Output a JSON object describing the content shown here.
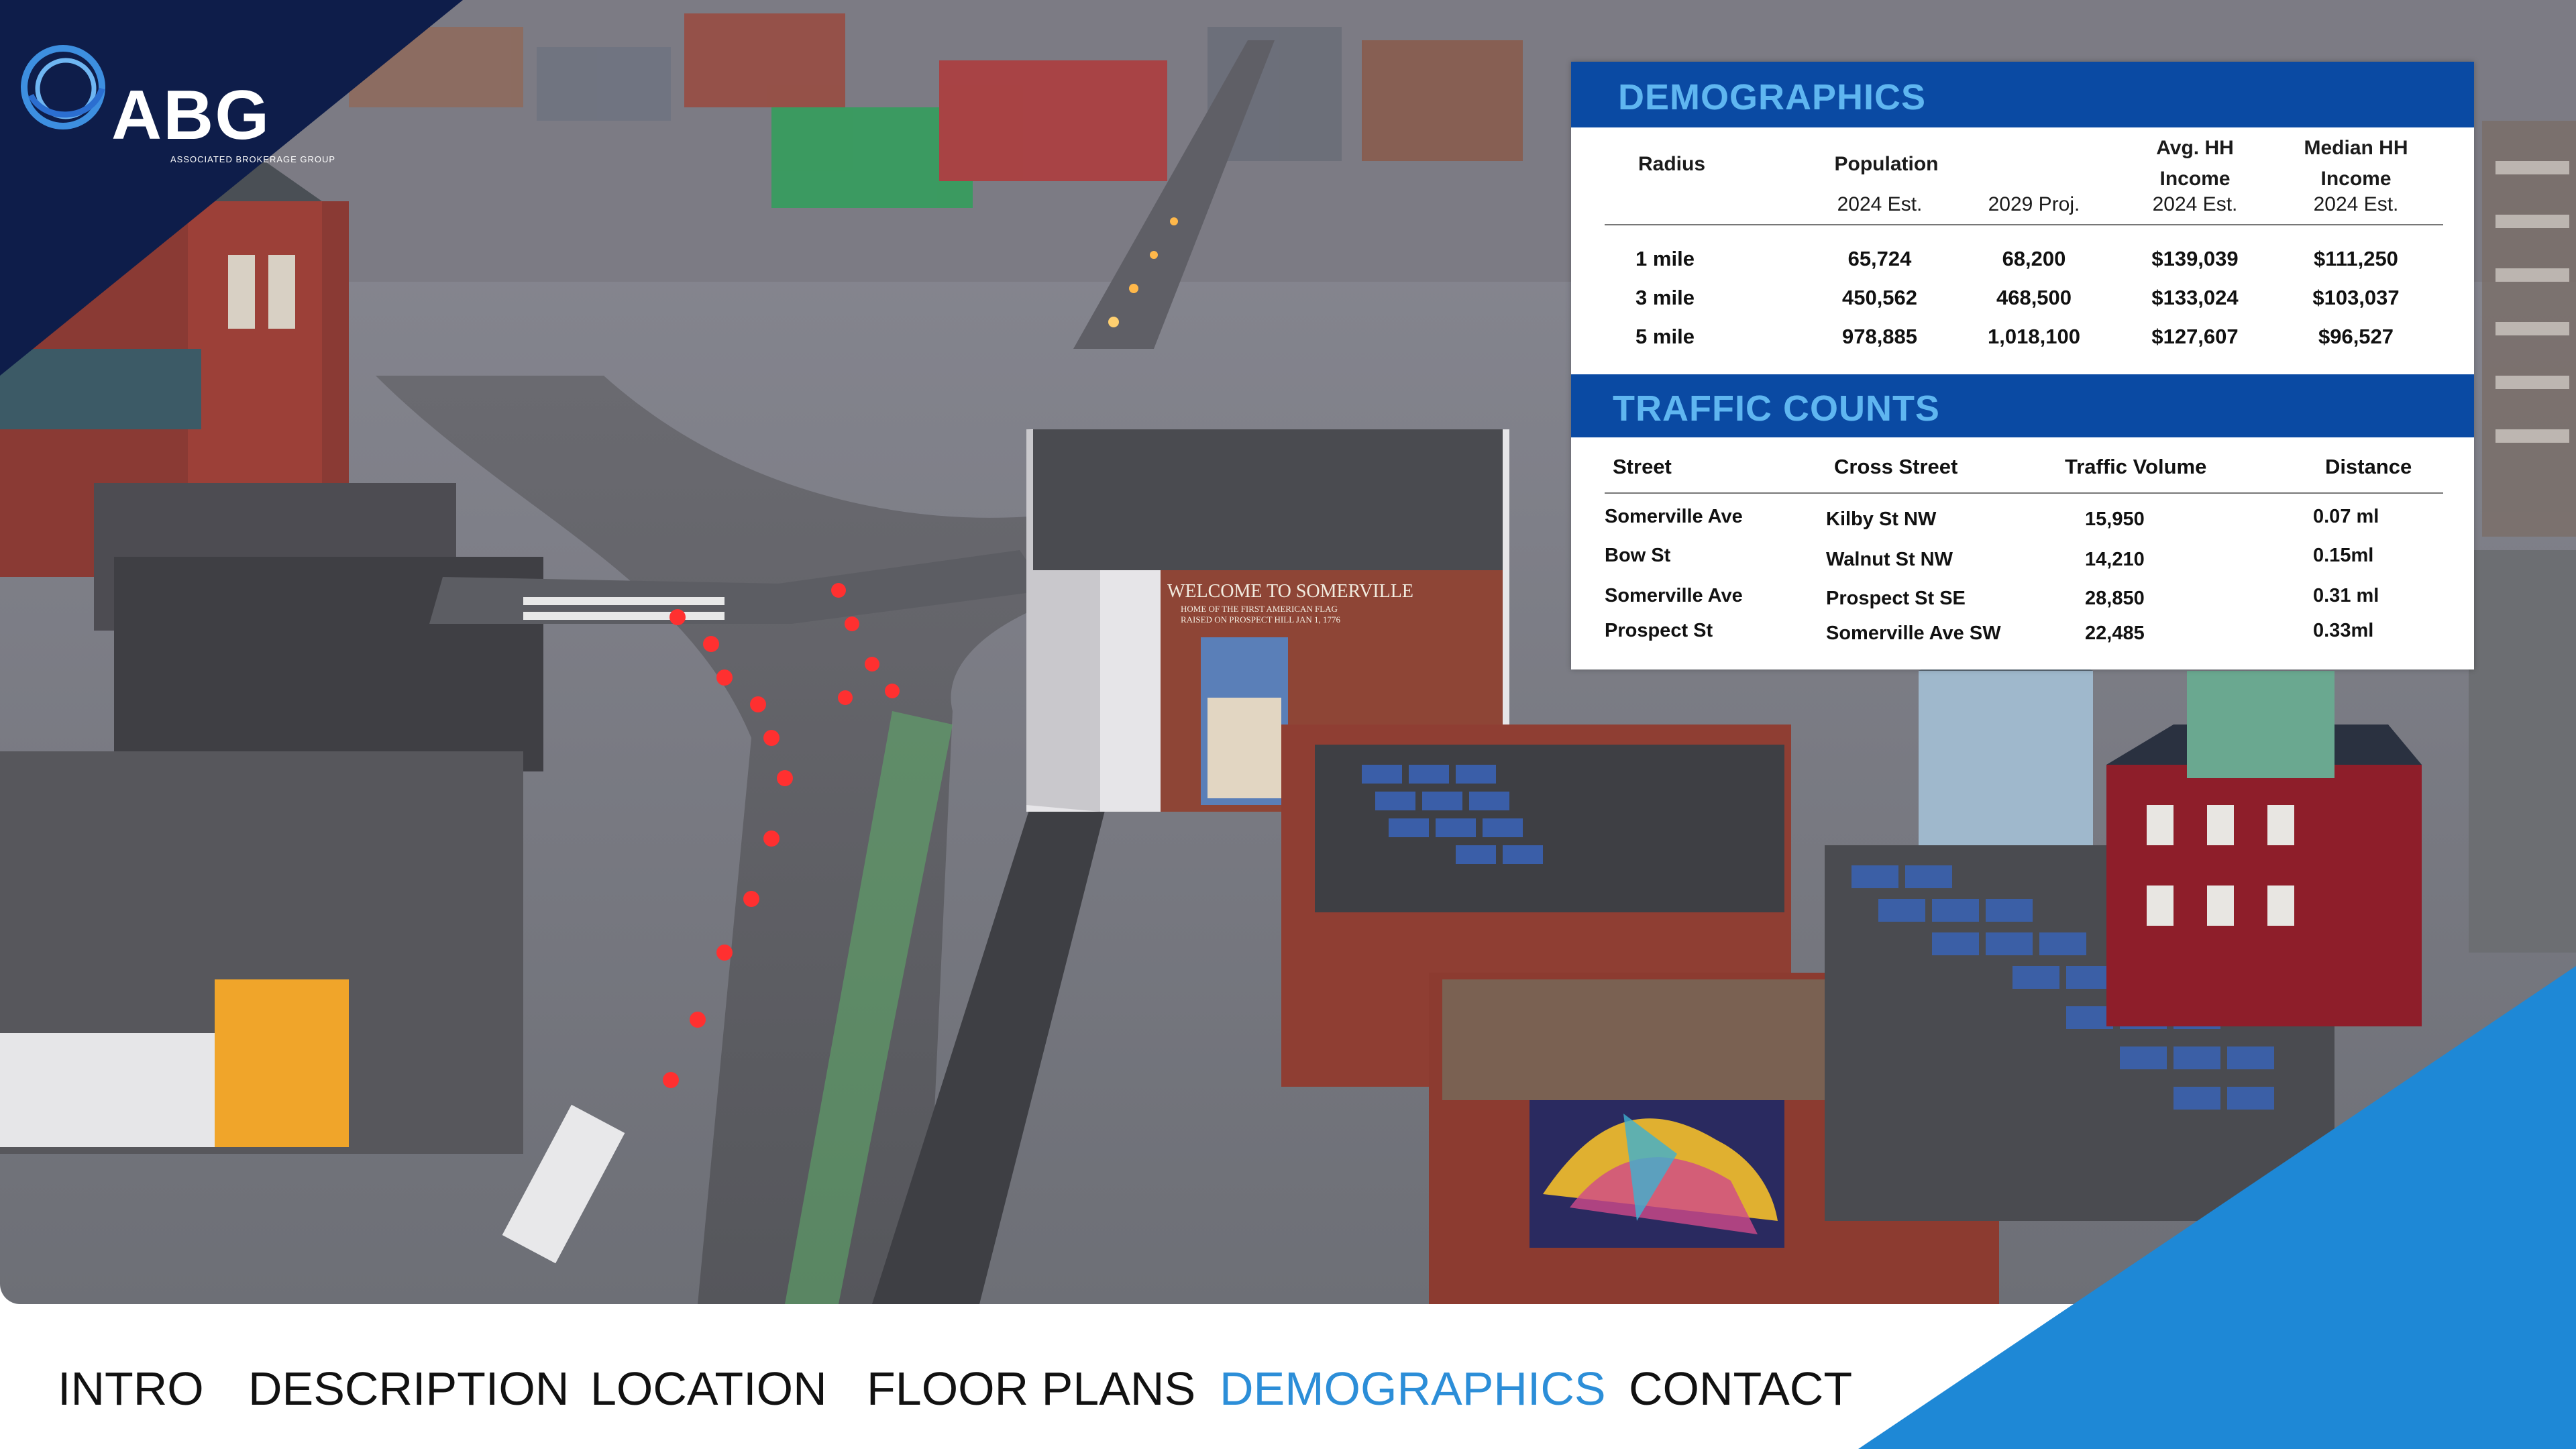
{
  "logo": {
    "text": "ABG",
    "subtitle": "ASSOCIATED BROKERAGE GROUP"
  },
  "colors": {
    "navy": "#0e1d4a",
    "band_blue": "#0a4aa3",
    "band_text": "#5fb6f0",
    "accent_blue": "#1e88d6",
    "nav_active": "#2c8ed8"
  },
  "demographics": {
    "title": "DEMOGRAPHICS",
    "headers": {
      "radius": "Radius",
      "population": "Population",
      "avg_income_1": "Avg. HH",
      "avg_income_2": "Income",
      "median_income_1": "Median HH",
      "median_income_2": "Income"
    },
    "subheaders": [
      "2024 Est.",
      "2029 Proj.",
      "2024 Est.",
      "2024 Est."
    ],
    "rows": [
      {
        "radius": "1 mile",
        "pop_2024": "65,724",
        "pop_2029": "68,200",
        "avg_income": "$139,039",
        "median_income": "$111,250"
      },
      {
        "radius": "3 mile",
        "pop_2024": "450,562",
        "pop_2029": "468,500",
        "avg_income": "$133,024",
        "median_income": "$103,037"
      },
      {
        "radius": "5 mile",
        "pop_2024": "978,885",
        "pop_2029": "1,018,100",
        "avg_income": "$127,607",
        "median_income": "$96,527"
      }
    ]
  },
  "traffic": {
    "title": "TRAFFIC COUNTS",
    "headers": {
      "street": "Street",
      "cross": "Cross Street",
      "volume": "Traffic Volume",
      "distance": "Distance"
    },
    "rows": [
      {
        "street": "Somerville Ave",
        "cross": "Kilby St NW",
        "volume": "15,950",
        "distance": "0.07 ml"
      },
      {
        "street": "Bow St",
        "cross": "Walnut St NW",
        "volume": "14,210",
        "distance": "0.15ml"
      },
      {
        "street": "Somerville Ave",
        "cross": "Prospect St SE",
        "volume": "28,850",
        "distance": "0.31 ml"
      },
      {
        "street": "Prospect St",
        "cross": "Somerville Ave SW",
        "volume": "22,485",
        "distance": "0.33ml"
      }
    ]
  },
  "photo": {
    "mural_sign_1": "WELCOME TO SOMERVILLE",
    "mural_sign_2": "HOME OF THE FIRST AMERICAN FLAG",
    "mural_sign_3": "RAISED ON PROSPECT HILL JAN 1, 1776"
  },
  "nav": [
    {
      "label": "INTRO",
      "active": false
    },
    {
      "label": "DESCRIPTION",
      "active": false
    },
    {
      "label": "LOCATION",
      "active": false
    },
    {
      "label": "FLOOR PLANS",
      "active": false
    },
    {
      "label": "DEMOGRAPHICS",
      "active": true
    },
    {
      "label": "CONTACT",
      "active": false
    }
  ]
}
